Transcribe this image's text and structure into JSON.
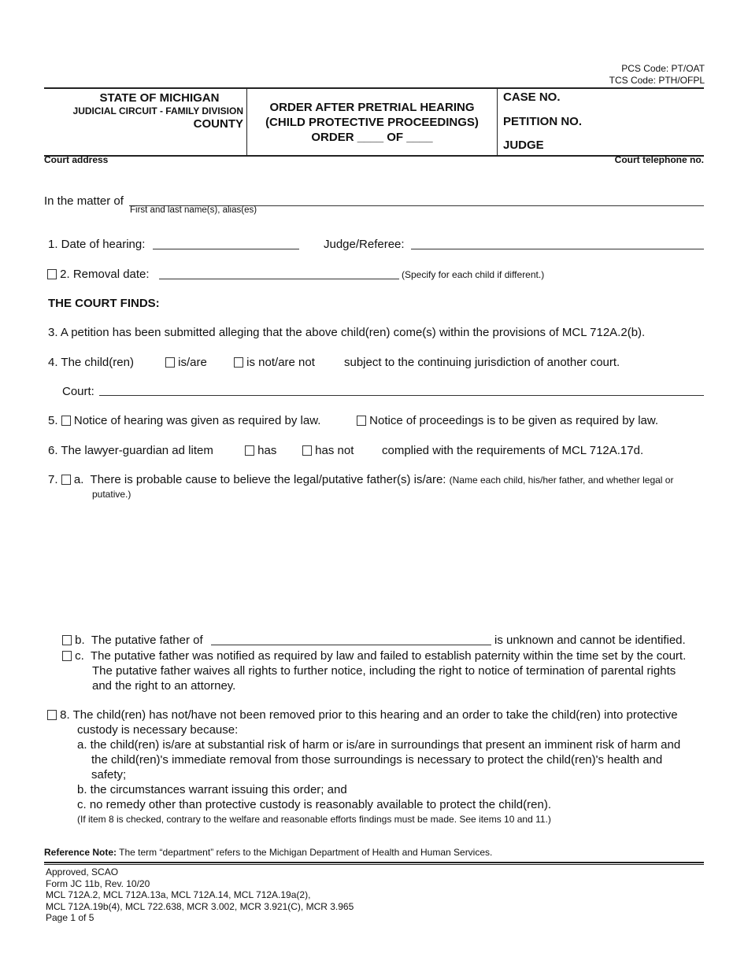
{
  "codes": {
    "pcs": "PCS Code: PT/OAT",
    "tcs": "TCS Code: PTH/OFPL"
  },
  "header": {
    "state": "STATE OF MICHIGAN",
    "circuit": "JUDICIAL CIRCUIT - FAMILY DIVISION",
    "county": "COUNTY",
    "title_line1": "ORDER AFTER PRETRIAL HEARING",
    "title_line2": "(CHILD PROTECTIVE PROCEEDINGS)",
    "title_line3": "ORDER ____ OF ____",
    "case_no": "CASE NO.",
    "petition_no": "PETITION NO.",
    "judge": "JUDGE",
    "court_address": "Court address",
    "court_telephone": "Court telephone no."
  },
  "matter": {
    "label": "In the matter of",
    "sublabel": "First and last name(s), alias(es)",
    "value": ""
  },
  "item1": {
    "label": "1. Date of hearing:",
    "date_value": "",
    "judge_label": "Judge/Referee:",
    "judge_value": ""
  },
  "item2": {
    "label": "2. Removal date:",
    "value": "",
    "note": "(Specify for each child if different.)",
    "checked": false
  },
  "court_finds": "THE COURT FINDS:",
  "item3": "3. A petition has been submitted alleging that the above child(ren) come(s) within the provisions of MCL 712A.2(b).",
  "item4": {
    "label": "4. The child(ren)",
    "opt1": "is/are",
    "opt2": "is not/are not",
    "rest": "subject to the continuing jurisdiction of another court.",
    "court_label": "Court:",
    "court_value": ""
  },
  "item5": {
    "num": "5.",
    "opt1": "Notice of hearing was given as required by law.",
    "opt2": "Notice of proceedings is to be given as required by law."
  },
  "item6": {
    "label": "6. The lawyer-guardian ad litem",
    "opt1": "has",
    "opt2": "has not",
    "rest": "complied with the requirements of MCL 712A.17d."
  },
  "item7": {
    "num": "7.",
    "a_label": "a.",
    "a_text": "There is probable cause to believe the legal/putative father(s) is/are:",
    "a_note1": "(Name each child, his/her father, and whether legal or",
    "a_note2": "putative.)",
    "b_label": "b.",
    "b_text1": "The putative father of",
    "b_value": "",
    "b_text2": "is unknown and cannot be identified.",
    "c_label": "c.",
    "c_line1": "The putative father was notified as required by law and failed to establish paternity within the time set by the court.",
    "c_line2": "The putative father waives all rights to further notice, including the right to notice of termination of parental rights",
    "c_line3": "and the right to an attorney."
  },
  "item8": {
    "num": "8.",
    "line1": "The child(ren) has not/have not been removed prior to this hearing and an order to take the child(ren) into protective",
    "line2": "custody is necessary because:",
    "a1": "a. the child(ren) is/are at substantial risk of harm or is/are in surroundings that present an imminent risk of harm and",
    "a2": "the child(ren)'s immediate removal from those surroundings is necessary to protect the child(ren)'s health and",
    "a3": "safety;",
    "b": "b. the circumstances warrant issuing this order; and",
    "c": "c. no remedy other than protective custody is reasonably available to protect the child(ren).",
    "note": "(If item 8 is checked, contrary to the welfare and reasonable efforts findings must be made. See items 10 and 11.)"
  },
  "reference": {
    "bold": "Reference Note:",
    "text": " The term “department” refers to the Michigan Department of Health and Human Services."
  },
  "footer": {
    "line1": "Approved, SCAO",
    "line2": "Form JC 11b, Rev. 10/20",
    "line3": "MCL 712A.2, MCL 712A.13a, MCL 712A.14, MCL 712A.19a(2),",
    "line4": "MCL 712A.19b(4), MCL 722.638, MCR 3.002, MCR 3.921(C), MCR 3.965",
    "line5": "Page 1 of 5"
  }
}
